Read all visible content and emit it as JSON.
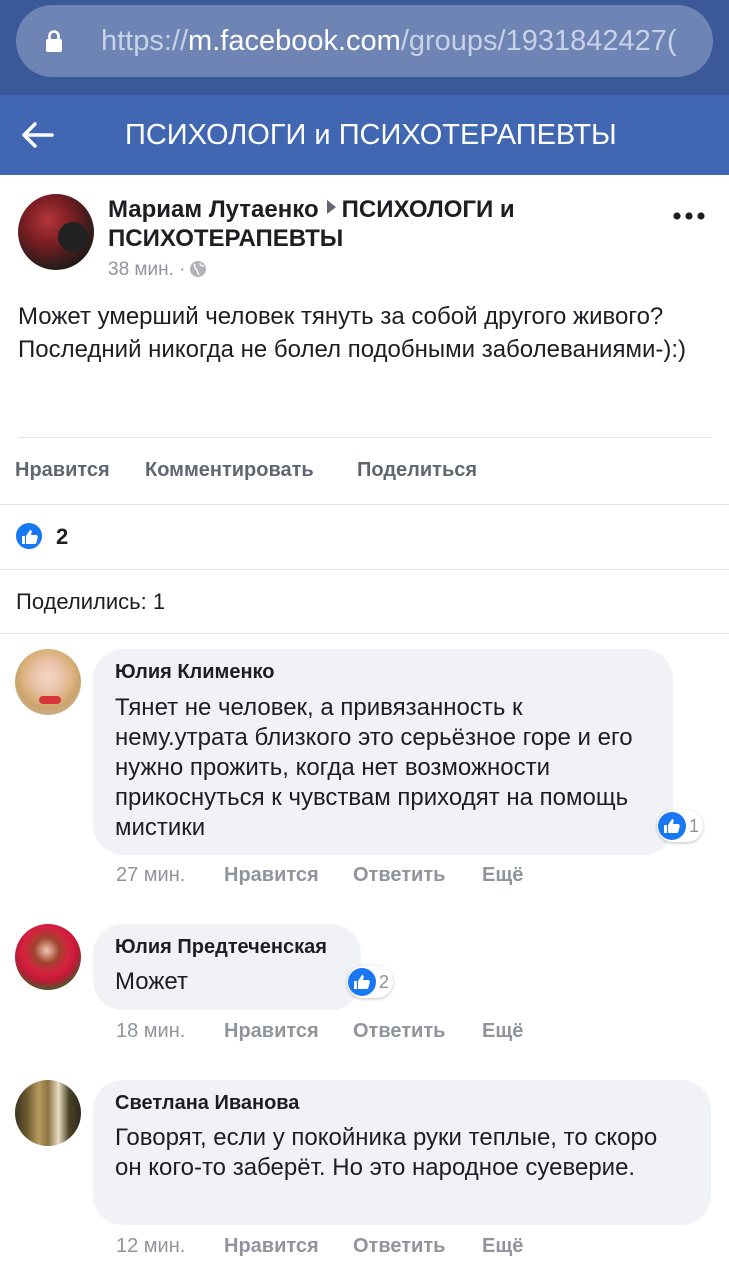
{
  "browser": {
    "url_scheme": "https://",
    "url_host": "m.facebook.com",
    "url_path": "/groups/1931842427("
  },
  "header": {
    "title": "ПСИХОЛОГИ и ПСИХОТЕРАПЕВТЫ"
  },
  "post": {
    "author": "Мариам Лутаенко",
    "group": "ПСИХОЛОГИ и ПСИХОТЕРАПЕВТЫ",
    "time": "38 мин. ·",
    "text": "Может умерший человек тянуть за собой другого живого?Последний никогда не болел подобными заболеваниями-):)",
    "actions": {
      "like": "Нравится",
      "comment": "Комментировать",
      "share": "Поделиться"
    },
    "reaction_count": "2",
    "shares": "Поделились: 1"
  },
  "comments": [
    {
      "author": "Юлия Клименко",
      "text": "Тянет не человек, а привязанность к нему.утрата близкого это серьёзное горе и его нужно прожить, когда нет возможности прикоснуться к чувствам приходят на помощь мистики",
      "reactions": "1",
      "time": "27 мин.",
      "like": "Нравится",
      "reply": "Ответить",
      "more": "Ещё"
    },
    {
      "author": "Юлия Предтеченская",
      "text": "Может",
      "reactions": "2",
      "time": "18 мин.",
      "like": "Нравится",
      "reply": "Ответить",
      "more": "Ещё"
    },
    {
      "author": "Светлана Иванова",
      "text": "Говорят, если у покойника руки теплые, то скоро он кого-то заберёт. Но это народное суеверие.",
      "time": "12 мин.",
      "like": "Нравится",
      "reply": "Ответить",
      "more": "Ещё"
    }
  ],
  "colors": {
    "header_bg": "#4267b2",
    "urlbar_bg": "#3b5998",
    "like_blue": "#1877f2",
    "bubble_bg": "#f0f2f5",
    "meta_gray": "#90949c"
  },
  "icons": [
    "lock-icon",
    "back-arrow-icon",
    "more-options-icon",
    "globe-icon",
    "like-icon"
  ]
}
